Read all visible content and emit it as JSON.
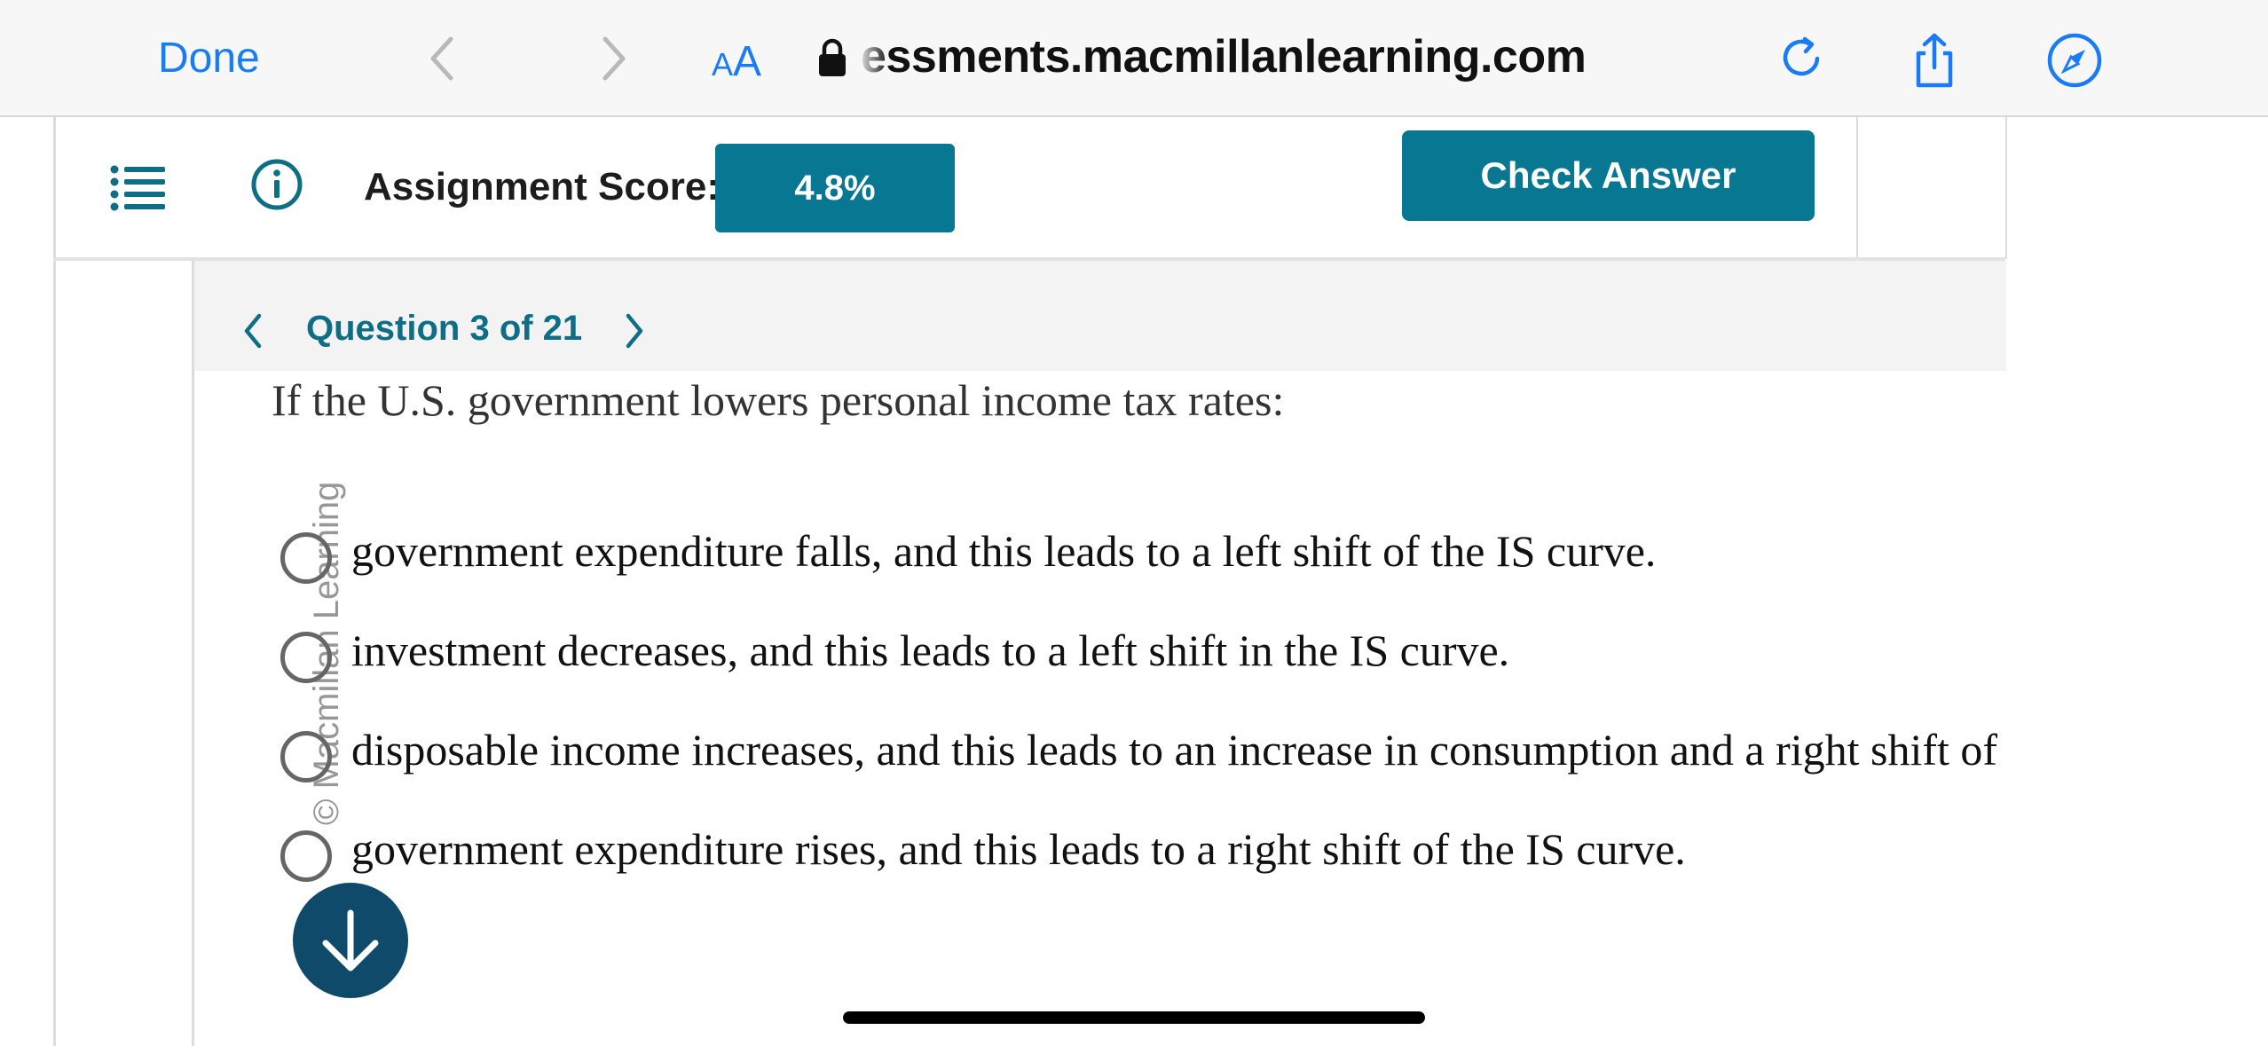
{
  "browser": {
    "done_label": "Done",
    "text_size_label_small": "A",
    "text_size_label_big": "A",
    "url": "essments.macmillanlearning.com"
  },
  "header": {
    "score_label": "Assignment Score:",
    "score_value": "4.8%",
    "check_answer_label": "Check Answer"
  },
  "question_nav": {
    "label": "Question 3 of 21"
  },
  "question": {
    "prompt": "If the U.S. government lowers personal income tax rates:",
    "watermark": "© Macmillan Learning",
    "options": [
      "government expenditure falls, and this leads to a left shift of the IS curve.",
      "investment decreases, and this leads to a left shift in the IS curve.",
      "disposable income increases, and this leads to an increase in consumption and a right shift of the IS curve.",
      "government expenditure rises, and this leads to a right shift of the IS curve."
    ]
  },
  "colors": {
    "accent": "#087791",
    "link_blue": "#1a7cf5",
    "scroll_button": "#0f4a6a"
  }
}
